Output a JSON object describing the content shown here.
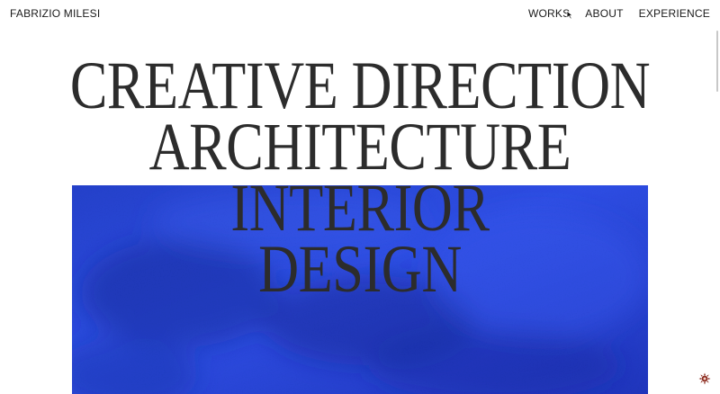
{
  "header": {
    "brand": "FABRIZIO MILESI",
    "nav": [
      {
        "label": "WORKS"
      },
      {
        "label": "ABOUT"
      },
      {
        "label": "EXPERIENCE"
      }
    ]
  },
  "hero": {
    "lines": [
      "CREATIVE DIRECTION",
      "ARCHITECTURE",
      "INTERIOR",
      "DESIGN"
    ],
    "image": "blue-textured-plaster"
  },
  "icons": {
    "cursor": "arrow-cursor-icon",
    "badge": "sun-badge-icon"
  },
  "colors": {
    "background": "#ffffff",
    "text": "#2c2c2c",
    "hero_blue": "#2a45d8",
    "badge": "#8b2a1e"
  }
}
